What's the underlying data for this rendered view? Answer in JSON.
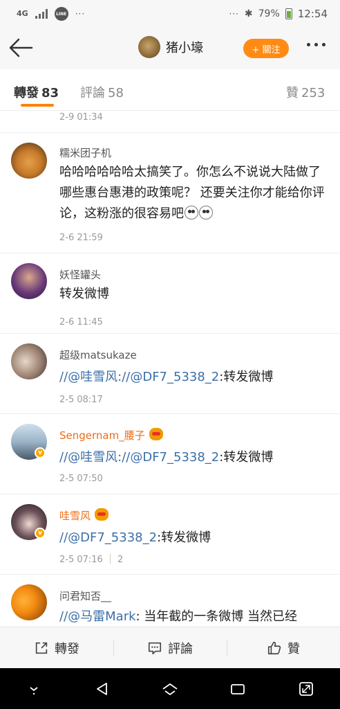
{
  "status": {
    "network": "4G",
    "time": "12:54",
    "battery": "79%",
    "battery_level": 0.79
  },
  "header": {
    "title": "猪小壕",
    "follow_label": "+ 關注"
  },
  "tabs": {
    "repost_label": "轉發",
    "repost_count": "83",
    "comment_label": "評論",
    "comment_count": "58",
    "like_label": "贊",
    "like_count": "253"
  },
  "comments": [
    {
      "name": "",
      "text": "",
      "time": "2-9 01:34"
    },
    {
      "name": "糯米团子机",
      "text": "哈哈哈哈哈哈太搞笑了。你怎么不说说大陆做了哪些惠台惠港的政策呢？ 还要关注你才能给你评论，这粉涨的很容易吧",
      "time": "2-6 21:59"
    },
    {
      "name": "妖怪罐头",
      "text": "转发微博",
      "time": "2-6 11:45"
    },
    {
      "name": "超级matsukaze",
      "m1": "//@哇雪风:",
      "m2": "//@DF7_5338_2",
      "tail": ":转发微博",
      "time": "2-5 08:17"
    },
    {
      "name": "Sengernam_腰子",
      "m1": "//@哇雪风:",
      "m2": "//@DF7_5338_2",
      "tail": ":转发微博",
      "time": "2-5 07:50"
    },
    {
      "name": "哇雪风",
      "m1": "//@DF7_5338_2",
      "tail": ":转发微博",
      "time": "2-5 07:16",
      "replies": "2"
    },
    {
      "name": "问君知否__",
      "m1": "//@马雷Mark",
      "tail": ": 当年截的一条微博 当然已经"
    }
  ],
  "actions": {
    "repost": "轉發",
    "comment": "評論",
    "like": "贊"
  },
  "colors": {
    "accent": "#ff8200",
    "follow": "#ff8b14",
    "mention": "#3b6fa8",
    "vip_name": "#f06b14"
  }
}
